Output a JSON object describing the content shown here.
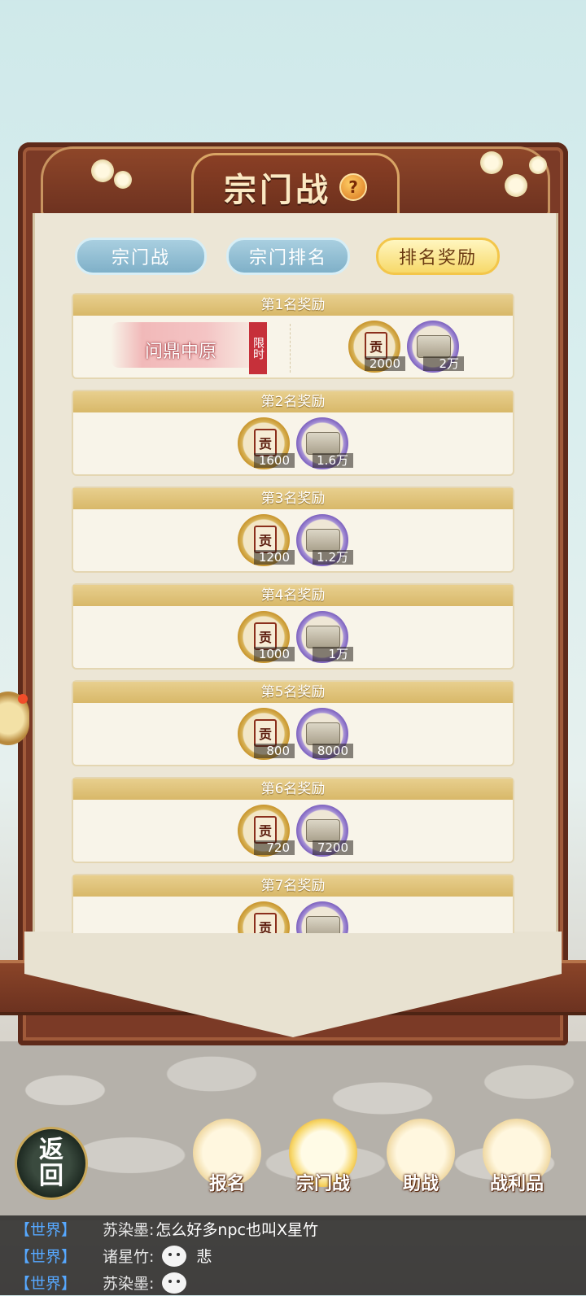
{
  "header": {
    "title": "宗门战",
    "help_label": "?"
  },
  "tabs": [
    {
      "label": "宗门战",
      "active": false
    },
    {
      "label": "宗门排名",
      "active": false
    },
    {
      "label": "排名奖励",
      "active": true
    }
  ],
  "rewards": [
    {
      "heading": "第1名奖励",
      "title_reward": "问鼎中原",
      "title_tag": "限时",
      "contribution": "2000",
      "silver": "2万"
    },
    {
      "heading": "第2名奖励",
      "contribution": "1600",
      "silver": "1.6万"
    },
    {
      "heading": "第3名奖励",
      "contribution": "1200",
      "silver": "1.2万"
    },
    {
      "heading": "第4名奖励",
      "contribution": "1000",
      "silver": "1万"
    },
    {
      "heading": "第5名奖励",
      "contribution": "800",
      "silver": "8000"
    },
    {
      "heading": "第6名奖励",
      "contribution": "720",
      "silver": "7200"
    },
    {
      "heading": "第7名奖励",
      "contribution": "",
      "silver": ""
    }
  ],
  "item_glyph": "贡",
  "nav": {
    "back": [
      "返",
      "回"
    ],
    "buttons": [
      {
        "label": "报名",
        "active": false
      },
      {
        "label": "宗门战",
        "active": true
      },
      {
        "label": "助战",
        "active": false
      },
      {
        "label": "战利品",
        "active": false
      }
    ]
  },
  "chat": [
    {
      "channel": "【世界】",
      "name": "苏染墨:",
      "message": "怎么好多npc也叫X星竹",
      "emoji": false
    },
    {
      "channel": "【世界】",
      "name": "诸星竹:",
      "message": "悲",
      "emoji": true
    },
    {
      "channel": "【世界】",
      "name": "苏染墨:",
      "message": "",
      "emoji": true
    }
  ],
  "colors": {
    "frame_wood": "#7b3a26",
    "tab_active": "#f7d96a",
    "tab_inactive": "#7fb0c8",
    "card_header": "#d8b869",
    "chat_channel": "#56a8ff"
  }
}
